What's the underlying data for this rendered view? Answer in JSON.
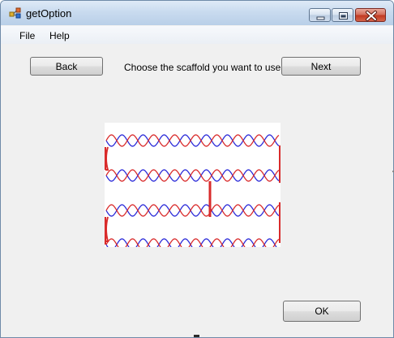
{
  "window": {
    "title": "getOption",
    "app_icon": "app-icon"
  },
  "caption_buttons": {
    "minimize": "minimize-icon",
    "maximize": "maximize-icon",
    "close": "close-icon"
  },
  "menu": {
    "items": [
      "File",
      "Help"
    ]
  },
  "toolbar": {
    "back_label": "Back",
    "prompt": "Choose the scaffold you want to use",
    "next_label": "Next"
  },
  "preview": {
    "icon": "scaffold-diagram",
    "strand_colors": [
      "#d92b2b",
      "#2b2bd9"
    ],
    "rows": 4
  },
  "footer": {
    "ok_label": "OK"
  }
}
